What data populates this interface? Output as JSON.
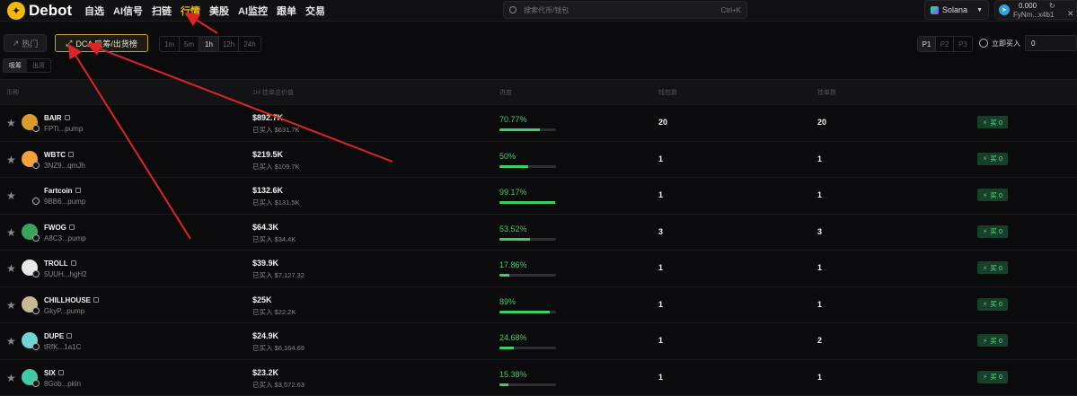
{
  "brand": {
    "name": "Debot"
  },
  "nav": [
    {
      "label": "自选"
    },
    {
      "label": "AI信号"
    },
    {
      "label": "扫链"
    },
    {
      "label": "行情",
      "active": true
    },
    {
      "label": "美股"
    },
    {
      "label": "AI监控"
    },
    {
      "label": "跟单"
    },
    {
      "label": "交易"
    }
  ],
  "search": {
    "placeholder": "搜索代币/钱包",
    "shortcut": "Ctrl+K"
  },
  "chain": {
    "label": "Solana"
  },
  "wallet": {
    "balance": "0.000",
    "address": "FyNm...x4b1"
  },
  "toolbar": {
    "hot_label": "热门",
    "dca_label": "DCA 吸筹/出货榜",
    "timeframes": [
      {
        "label": "1m"
      },
      {
        "label": "5m"
      },
      {
        "label": "1h",
        "active": true
      },
      {
        "label": "12h"
      },
      {
        "label": "24h"
      }
    ],
    "pages": [
      {
        "label": "P1",
        "active": true
      },
      {
        "label": "P2"
      },
      {
        "label": "P3"
      }
    ],
    "instant_buy_label": "立即买入",
    "instant_buy_value": "0"
  },
  "subtabs": [
    {
      "label": "吸筹",
      "active": true
    },
    {
      "label": "出货"
    }
  ],
  "table": {
    "headers": {
      "token": "币种",
      "total": "1H 挂单总价值",
      "progress": "进度",
      "wallets": "钱包数",
      "orders": "挂单数"
    },
    "buy_label": "买 0",
    "rows": [
      {
        "symbol": "BAIR",
        "address": "FPTi...pump",
        "total": "$892.7K",
        "bought": "已买入 $631.7K",
        "progress": "70.77%",
        "progress_value": 70.77,
        "wallets": "20",
        "orders": "20",
        "avatar_color": "#d89b2a"
      },
      {
        "symbol": "WBTC",
        "address": "3NZ9...qmJh",
        "total": "$219.5K",
        "bought": "已买入 $109.7K",
        "progress": "50%",
        "progress_value": 50,
        "wallets": "1",
        "orders": "1",
        "avatar_color": "#f2a13b"
      },
      {
        "symbol": "Fartcoin",
        "address": "9BB6...pump",
        "total": "$132.6K",
        "bought": "已买入 $131.5K",
        "progress": "99.17%",
        "progress_value": 99.17,
        "wallets": "1",
        "orders": "1",
        "avatar_color": "#0b0b0d"
      },
      {
        "symbol": "FWOG",
        "address": "A8C3...pump",
        "total": "$64.3K",
        "bought": "已买入 $34.4K",
        "progress": "53.52%",
        "progress_value": 53.52,
        "wallets": "3",
        "orders": "3",
        "avatar_color": "#3aa35a"
      },
      {
        "symbol": "TROLL",
        "address": "5UUH...hgH2",
        "total": "$39.9K",
        "bought": "已买入 $7,127.32",
        "progress": "17.86%",
        "progress_value": 17.86,
        "wallets": "1",
        "orders": "1",
        "avatar_color": "#e8e8e8"
      },
      {
        "symbol": "CHILLHOUSE",
        "address": "GkyP...pump",
        "total": "$25K",
        "bought": "已买入 $22.2K",
        "progress": "89%",
        "progress_value": 89,
        "wallets": "1",
        "orders": "1",
        "avatar_color": "#c9b894"
      },
      {
        "symbol": "DUPE",
        "address": "tRfK...1a1C",
        "total": "$24.9K",
        "bought": "已买入 $6,164.69",
        "progress": "24.68%",
        "progress_value": 24.68,
        "wallets": "1",
        "orders": "2",
        "avatar_color": "#6fd7d0"
      },
      {
        "symbol": "SIX",
        "address": "8Gob...pkin",
        "total": "$23.2K",
        "bought": "已买入 $3,572.63",
        "progress": "15.38%",
        "progress_value": 15.38,
        "wallets": "1",
        "orders": "1",
        "avatar_color": "#42c9a8"
      }
    ]
  }
}
